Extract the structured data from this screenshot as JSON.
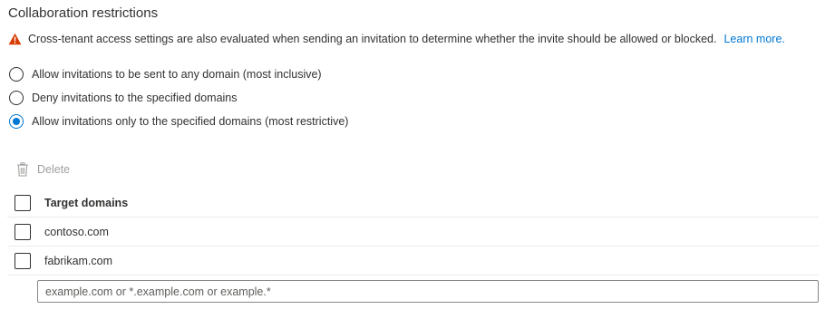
{
  "section": {
    "title": "Collaboration restrictions"
  },
  "warning": {
    "icon": "warning-icon",
    "icon_color": "#d83b01",
    "text": "Cross-tenant access settings are also evaluated when sending an invitation to determine whether the invite should be allowed or blocked.",
    "link_text": "Learn more."
  },
  "options": [
    {
      "label": "Allow invitations to be sent to any domain (most inclusive)",
      "selected": false
    },
    {
      "label": "Deny invitations to the specified domains",
      "selected": false
    },
    {
      "label": "Allow invitations only to the specified domains (most restrictive)",
      "selected": true
    }
  ],
  "toolbar": {
    "delete_label": "Delete",
    "delete_icon": "trash-icon",
    "delete_enabled": false
  },
  "table": {
    "header": "Target domains",
    "rows": [
      {
        "domain": "contoso.com",
        "checked": false
      },
      {
        "domain": "fabrikam.com",
        "checked": false
      }
    ]
  },
  "input": {
    "placeholder": "example.com or *.example.com or example.*",
    "value": ""
  },
  "colors": {
    "accent": "#0078d4",
    "text": "#323130",
    "disabled": "#a19f9d",
    "divider": "#edebe9"
  }
}
